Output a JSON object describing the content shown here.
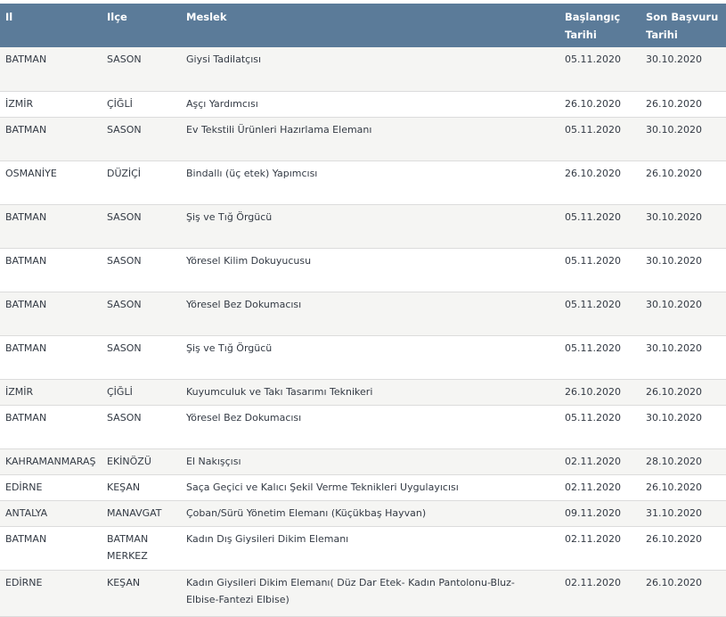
{
  "columns": {
    "il": "Il",
    "ilce": "Ilçe",
    "meslek": "Meslek",
    "baslangic": [
      "Başlangıç",
      "Tarihi"
    ],
    "son_basvuru": [
      "Son Başvuru",
      "Tarihi"
    ]
  },
  "rows": [
    {
      "il": "BATMAN",
      "ilce": [
        "SASON"
      ],
      "meslek": [
        "Giysi Tadilatçısı"
      ],
      "baslangic": "05.11.2020",
      "son": "30.10.2020"
    },
    {
      "il": "İZMİR",
      "ilce": [
        "ÇİĞLİ"
      ],
      "meslek": [
        "Aşçı Yardımcısı"
      ],
      "baslangic": "26.10.2020",
      "son": "26.10.2020"
    },
    {
      "il": "BATMAN",
      "ilce": [
        "SASON"
      ],
      "meslek": [
        "Ev Tekstili Ürünleri Hazırlama Elemanı"
      ],
      "baslangic": "05.11.2020",
      "son": "30.10.2020"
    },
    {
      "il": "OSMANİYE",
      "ilce": [
        "DÜZİÇİ"
      ],
      "meslek": [
        "Bindallı (üç etek) Yapımcısı"
      ],
      "baslangic": "26.10.2020",
      "son": "26.10.2020"
    },
    {
      "il": "BATMAN",
      "ilce": [
        "SASON"
      ],
      "meslek": [
        "Şiş ve Tığ Örgücü"
      ],
      "baslangic": "05.11.2020",
      "son": "30.10.2020"
    },
    {
      "il": "BATMAN",
      "ilce": [
        "SASON"
      ],
      "meslek": [
        "Yöresel Kilim Dokuyucusu"
      ],
      "baslangic": "05.11.2020",
      "son": "30.10.2020"
    },
    {
      "il": "BATMAN",
      "ilce": [
        "SASON"
      ],
      "meslek": [
        "Yöresel Bez Dokumacısı"
      ],
      "baslangic": "05.11.2020",
      "son": "30.10.2020"
    },
    {
      "il": "BATMAN",
      "ilce": [
        "SASON"
      ],
      "meslek": [
        "Şiş ve Tığ Örgücü"
      ],
      "baslangic": "05.11.2020",
      "son": "30.10.2020"
    },
    {
      "il": "İZMİR",
      "ilce": [
        "ÇİĞLİ"
      ],
      "meslek": [
        "Kuyumculuk ve Takı Tasarımı Teknikeri"
      ],
      "baslangic": "26.10.2020",
      "son": "26.10.2020"
    },
    {
      "il": "BATMAN",
      "ilce": [
        "SASON"
      ],
      "meslek": [
        "Yöresel Bez Dokumacısı"
      ],
      "baslangic": "05.11.2020",
      "son": "30.10.2020"
    },
    {
      "il": "KAHRAMANMARAŞ",
      "ilce": [
        "EKİNÖZÜ"
      ],
      "meslek": [
        "El Nakışçısı"
      ],
      "baslangic": "02.11.2020",
      "son": "28.10.2020"
    },
    {
      "il": "EDİRNE",
      "ilce": [
        "KEŞAN"
      ],
      "meslek": [
        "Saça Geçici ve Kalıcı Şekil Verme Teknikleri Uygulayıcısı"
      ],
      "baslangic": "02.11.2020",
      "son": "26.10.2020"
    },
    {
      "il": "ANTALYA",
      "ilce": [
        "MANAVGAT"
      ],
      "meslek": [
        "Çoban/Sürü Yönetim Elemanı (Küçükbaş Hayvan)"
      ],
      "baslangic": "09.11.2020",
      "son": "31.10.2020"
    },
    {
      "il": "BATMAN",
      "ilce": [
        "BATMAN",
        "MERKEZ"
      ],
      "meslek": [
        "Kadın Dış Giysileri Dikim Elemanı"
      ],
      "baslangic": "02.11.2020",
      "son": "26.10.2020"
    },
    {
      "il": "EDİRNE",
      "ilce": [
        "KEŞAN"
      ],
      "meslek": [
        "Kadın Giysileri Dikim Elemanı( Düz Dar Etek- Kadın Pantolonu-Bluz-",
        "Elbise-Fantezi Elbise)"
      ],
      "baslangic": "02.11.2020",
      "son": "26.10.2020"
    }
  ]
}
